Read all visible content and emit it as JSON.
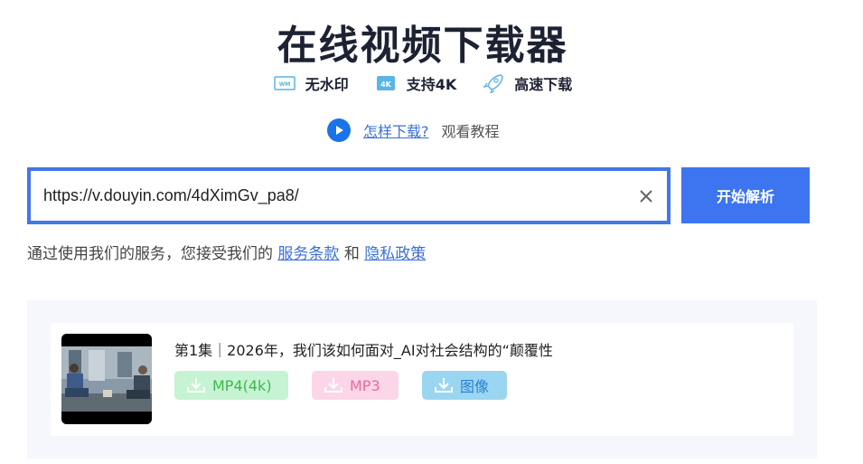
{
  "header": {
    "title": "在线视频下载器",
    "features": [
      {
        "icon": "watermark-icon",
        "label": "无水印"
      },
      {
        "icon": "4k-icon",
        "label": "支持4K"
      },
      {
        "icon": "rocket-icon",
        "label": "高速下载"
      }
    ]
  },
  "howto": {
    "link": "怎样下载?",
    "text": "观看教程"
  },
  "search": {
    "value": "https://v.douyin.com/4dXimGv_pa8/",
    "button": "开始解析"
  },
  "terms": {
    "prefix": "通过使用我们的服务，您接受我们的",
    "service": "服务条款",
    "and": "和",
    "privacy": "隐私政策"
  },
  "result": {
    "title": "第1集｜2026年，我们该如何面对_AI对社会结构的“颠覆性",
    "buttons": {
      "mp4": "MP4(4k)",
      "mp3": "MP3",
      "image": "图像"
    }
  },
  "colors": {
    "accent": "#3d74f0",
    "mp4": "#3fb84d",
    "mp3": "#ea6aa1",
    "image": "#2a7fd4"
  }
}
